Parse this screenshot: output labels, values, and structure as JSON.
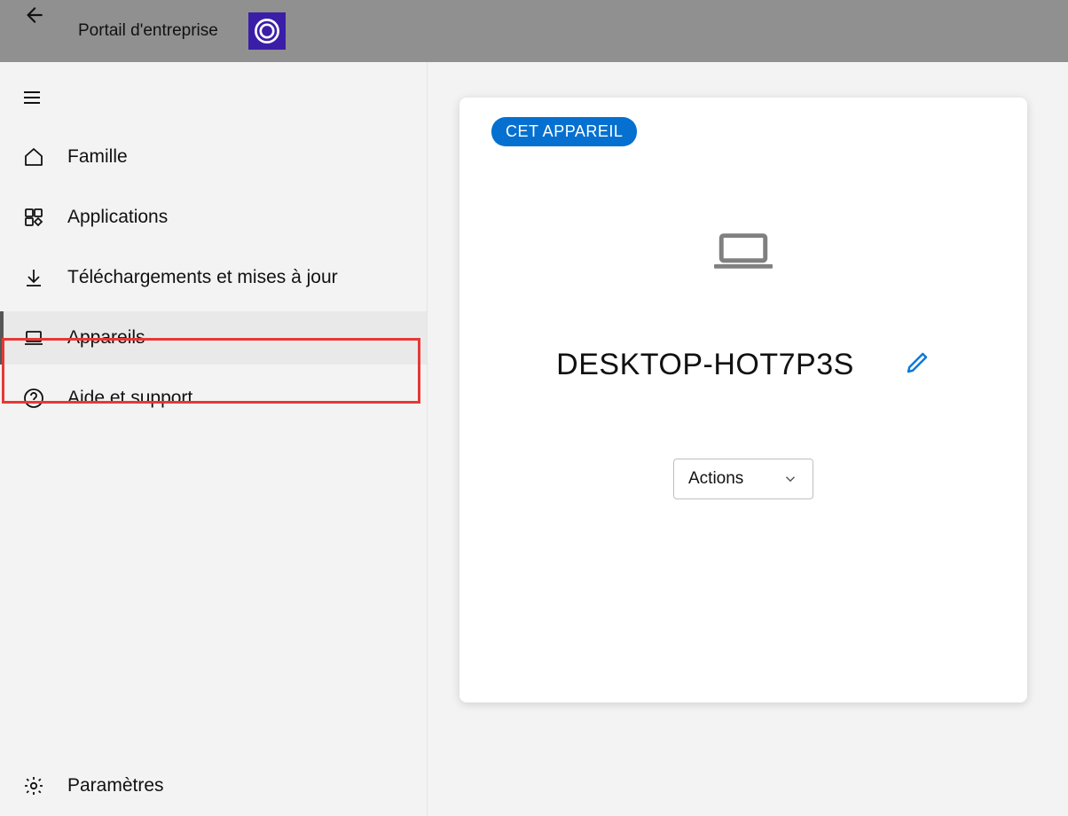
{
  "header": {
    "app_title": "Portail d'entreprise"
  },
  "sidebar": {
    "items": [
      {
        "label": "Famille"
      },
      {
        "label": "Applications"
      },
      {
        "label": "Téléchargements et mises à jour"
      },
      {
        "label": "Appareils"
      },
      {
        "label": "Aide et support"
      }
    ],
    "settings_label": "Paramètres"
  },
  "card": {
    "badge": "CET APPAREIL",
    "device_name": "DESKTOP-HOT7P3S",
    "actions_label": "Actions"
  }
}
